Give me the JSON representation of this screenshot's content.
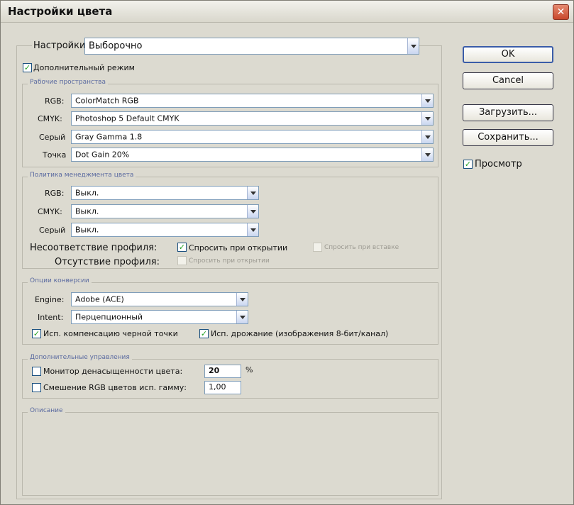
{
  "window": {
    "title": "Настройки цвета",
    "close_glyph": "✕"
  },
  "settings": {
    "label": "Настройки",
    "value": "Выборочно"
  },
  "advanced_mode": {
    "label": "Дополнительный режим",
    "checked": true
  },
  "working_spaces": {
    "legend": "Рабочие пространства",
    "rows": [
      {
        "label": "RGB:",
        "value": "ColorMatch RGB"
      },
      {
        "label": "CMYK:",
        "value": "Photoshop 5 Default CMYK"
      },
      {
        "label": "Серый",
        "value": "Gray Gamma 1.8"
      },
      {
        "label": "Точка",
        "value": "Dot Gain 20%"
      }
    ]
  },
  "policies": {
    "legend": "Политика менеджмента цвета",
    "rows": [
      {
        "label": "RGB:",
        "value": "Выкл."
      },
      {
        "label": "CMYK:",
        "value": "Выкл."
      },
      {
        "label": "Серый",
        "value": "Выкл."
      }
    ],
    "mismatch_label": "Несоответствие профиля:",
    "ask_open_label": "Спросить при открытии",
    "ask_paste_label": "Спросить при вставке",
    "missing_label": "Отсутствие профиля:",
    "missing_ask_open_label": "Спросить при открытии"
  },
  "conversion": {
    "legend": "Опции конверсии",
    "engine_label": "Engine:",
    "engine_value": "Adobe (ACE)",
    "intent_label": "Intent:",
    "intent_value": "Перцепционный",
    "bpc_label": "Исп. компенсацию черной точки",
    "dither_label": "Исп. дрожание (изображения 8-бит/канал)"
  },
  "advanced_controls": {
    "legend": "Дополнительные управления",
    "desaturate_label": "Монитор денасыщенности цвета:",
    "desaturate_value": "20",
    "desaturate_unit": "%",
    "blend_label": "Смешение RGB цветов исп. гамму:",
    "blend_value": "1,00"
  },
  "description": {
    "legend": "Описание"
  },
  "buttons": {
    "ok": "OK",
    "cancel": "Cancel",
    "load": "Загрузить...",
    "save": "Сохранить..."
  },
  "preview": {
    "label": "Просмотр",
    "checked": true
  },
  "check_glyph": "✓"
}
